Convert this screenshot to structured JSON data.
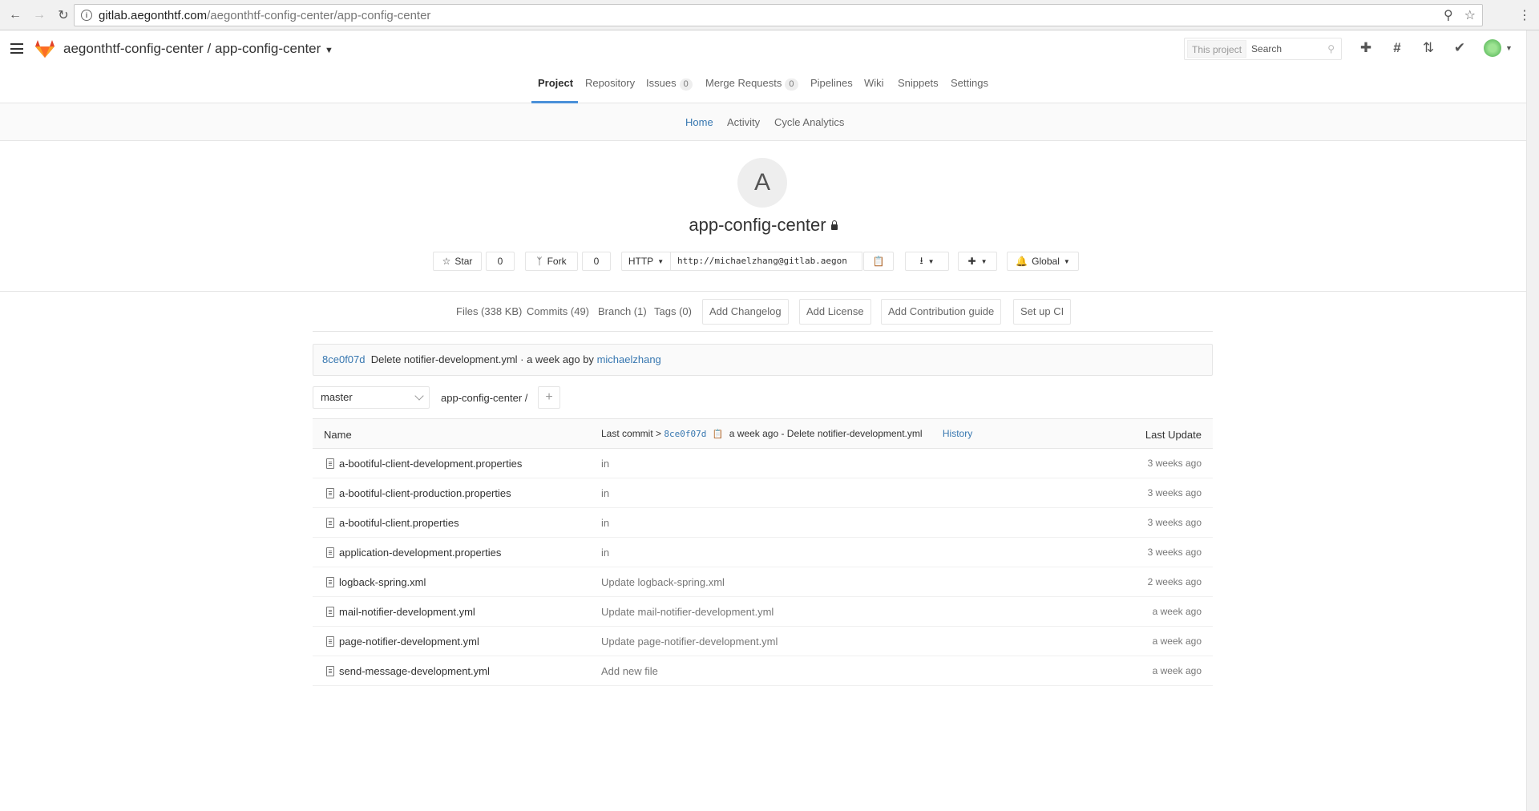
{
  "browser": {
    "url_host": "gitlab.aegonthtf.com",
    "url_path": "/aegonthtf-config-center/app-config-center"
  },
  "header": {
    "project_path": "aegonthtf-config-center / app-config-center",
    "search_scope": "This project",
    "search_placeholder": "Search"
  },
  "project_nav": {
    "items": [
      {
        "label": "Project"
      },
      {
        "label": "Repository"
      },
      {
        "label": "Issues",
        "badge": "0"
      },
      {
        "label": "Merge Requests",
        "badge": "0"
      },
      {
        "label": "Pipelines"
      },
      {
        "label": "Wiki"
      },
      {
        "label": "Snippets"
      },
      {
        "label": "Settings"
      }
    ]
  },
  "sub_nav": {
    "items": [
      {
        "label": "Home"
      },
      {
        "label": "Activity"
      },
      {
        "label": "Cycle Analytics"
      }
    ]
  },
  "project": {
    "avatar_letter": "A",
    "name": "app-config-center",
    "star_label": "Star",
    "star_count": "0",
    "fork_label": "Fork",
    "fork_count": "0",
    "protocol": "HTTP",
    "clone_url": "http://michaelzhang@gitlab.aegon",
    "notification": "Global"
  },
  "stats": {
    "files": "Files (338 KB)",
    "commits": "Commits (49)",
    "branch": "Branch (1)",
    "tags": "Tags (0)",
    "add_changelog": "Add Changelog",
    "add_license": "Add License",
    "add_contribution": "Add Contribution guide",
    "setup_ci": "Set up CI"
  },
  "last_commit": {
    "sha": "8ce0f07d",
    "message": "Delete notifier-development.yml · a week ago by",
    "author": "michaelzhang"
  },
  "tree": {
    "branch": "master",
    "breadcrumb": "app-config-center  /",
    "head_name": "Name",
    "head_last_commit": "Last commit",
    "head_sha": "8ce0f07d",
    "head_commit_msg": "a week ago - Delete notifier-development.yml",
    "head_history": "History",
    "head_last_update": "Last Update",
    "rows": [
      {
        "name": "a-bootiful-client-development.properties",
        "msg": "in",
        "date": "3 weeks ago"
      },
      {
        "name": "a-bootiful-client-production.properties",
        "msg": "in",
        "date": "3 weeks ago"
      },
      {
        "name": "a-bootiful-client.properties",
        "msg": "in",
        "date": "3 weeks ago"
      },
      {
        "name": "application-development.properties",
        "msg": "in",
        "date": "3 weeks ago"
      },
      {
        "name": "logback-spring.xml",
        "msg": "Update logback-spring.xml",
        "date": "2 weeks ago"
      },
      {
        "name": "mail-notifier-development.yml",
        "msg": "Update mail-notifier-development.yml",
        "date": "a week ago"
      },
      {
        "name": "page-notifier-development.yml",
        "msg": "Update page-notifier-development.yml",
        "date": "a week ago"
      },
      {
        "name": "send-message-development.yml",
        "msg": "Add new file",
        "date": "a week ago"
      }
    ]
  }
}
